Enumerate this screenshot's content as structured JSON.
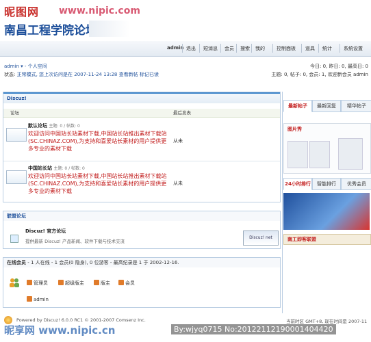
{
  "header": {
    "watermark": "昵图网",
    "watermark_url": "www.nipic.com",
    "forum_title": "南昌工程学院论坛"
  },
  "nav": {
    "items": [
      "admin",
      "退出",
      "短消息",
      "会员",
      "搜索",
      "我的",
      "控制面板",
      "道具",
      "统计",
      "系统设置"
    ]
  },
  "user": {
    "username": "admin",
    "space_link": "个人空间",
    "status_label": "状态:",
    "status_text": "正常模式, 您上次访问是在 2007-11-24 13:28",
    "view_new": "查看新帖",
    "mark_read": "标记已读"
  },
  "stats": {
    "line1": "今日: 0, 昨日: 0, 最高日: 0",
    "line2": "主题: 0, 帖子: 0, 会员: 1, 欢迎新会员 admin"
  },
  "forum_box": {
    "title": "Discuz!",
    "col_forum": "论坛",
    "col_lastpost": "最后发表",
    "forums": [
      {
        "name": "默认论坛",
        "meta": "主题: 0 / 帖数: 0",
        "desc": "欢迎访问中国站长站素材下载,中国站长站推出素材下载站(SC.CHINAZ.COM),为支持和喜爱站长素材的用户提供更多专业的素材下载",
        "lastpost": "从未"
      },
      {
        "name": "中国站长站",
        "meta": "主题: 0 / 帖数: 0",
        "desc": "欢迎访问中国站长站素材下载,中国站长站推出素材下载站(SC.CHINAZ.COM),为支持和喜爱站长素材的用户提供更多专业的素材下载",
        "lastpost": "从未"
      }
    ]
  },
  "union_box": {
    "title": "联盟论坛",
    "name": "Discuz! 官方论坛",
    "desc": "提供最新 Discuz! 产品新闻、软件下载与技术交流",
    "logo": "Discuz! net"
  },
  "online_box": {
    "title_bold": "在线会员",
    "title_rest": "- 1 人在线 - 1 会员(0 隐身), 0 位游客 - 最高纪录是 1 于 2002-12-16.",
    "legend": [
      "管理员",
      "超级版主",
      "版主",
      "会员"
    ],
    "online_user": "admin"
  },
  "right_col": {
    "tabs_top": [
      "最新帖子",
      "最新回复",
      "精华帖子"
    ],
    "pic_label": "图片秀",
    "tabs_mid": [
      "24小时排行",
      "智能排行",
      "优秀会员"
    ],
    "union_link": "南工即客联盟"
  },
  "footer": {
    "powered": "Powered by Discuz! 6.0.0 RC1 © 2001-2007 Comsenz Inc.",
    "time": "当前时区 GMT+8, 现在时间是 2007-11",
    "watermark": "昵享网 www.nipic.cn",
    "by": "By:wjyq0715 No:20122112190001404420",
    "colors": {
      "accent": "#3a82c8",
      "title_blue": "#1d4f9a",
      "desc_red": "#c21c1c"
    }
  }
}
